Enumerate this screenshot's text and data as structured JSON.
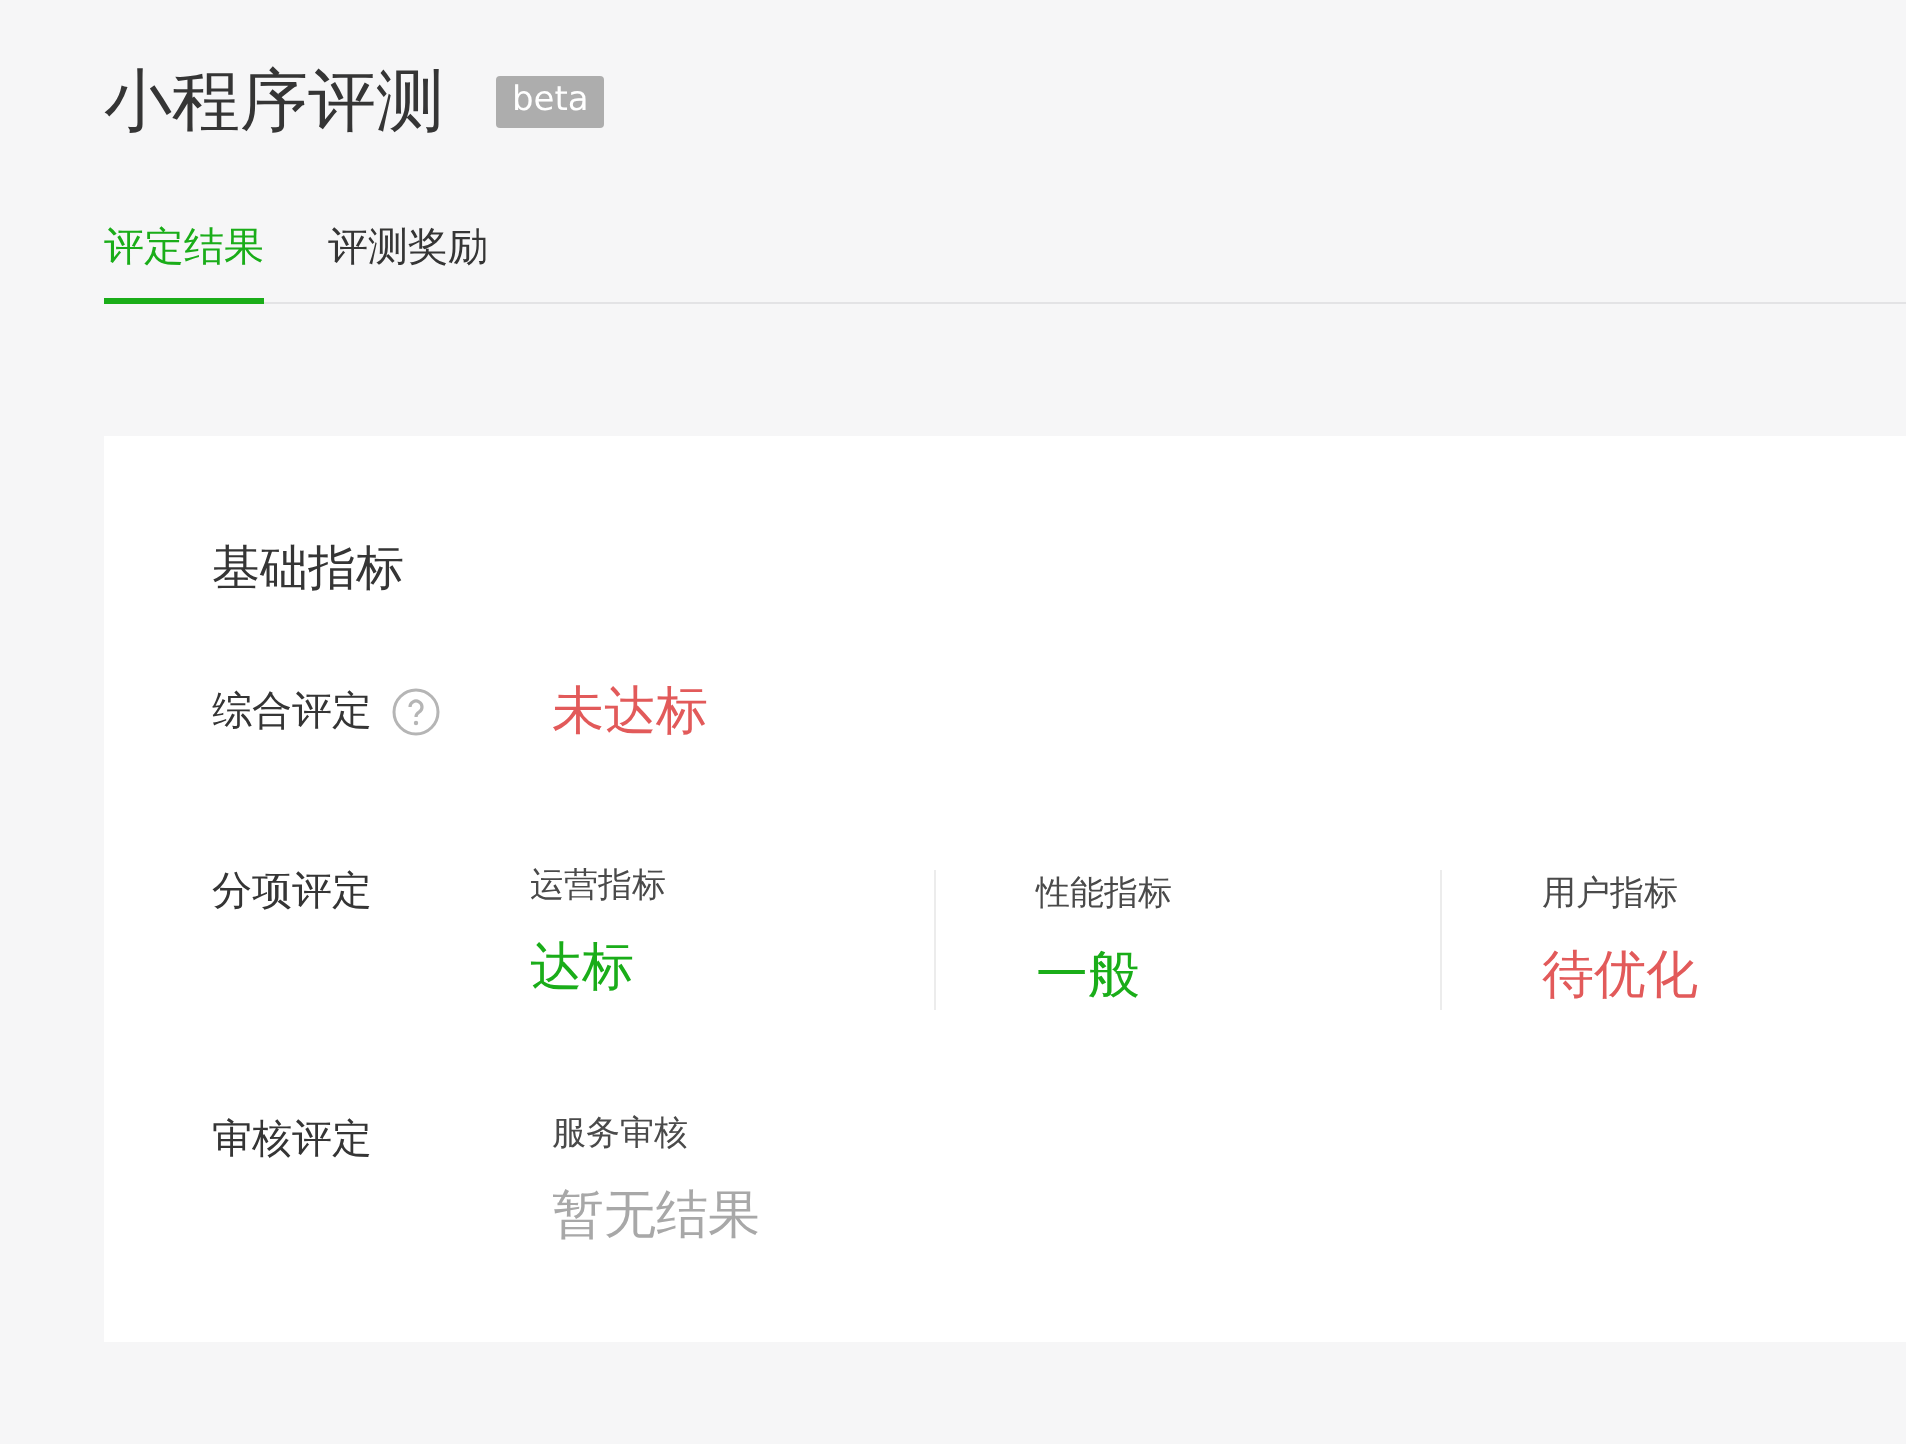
{
  "header": {
    "title": "小程序评测",
    "badge": "beta"
  },
  "tabs": [
    {
      "label": "评定结果",
      "selected": true
    },
    {
      "label": "评测奖励",
      "selected": false
    }
  ],
  "card": {
    "title": "基础指标",
    "overall": {
      "label": "综合评定",
      "result": "未达标",
      "kind": "bad"
    },
    "rows": [
      {
        "label": "分项评定",
        "items": [
          {
            "name": "运营指标",
            "result": "达标",
            "kind": "good"
          },
          {
            "name": "性能指标",
            "result": "一般",
            "kind": "good"
          },
          {
            "name": "用户指标",
            "result": "待优化",
            "kind": "bad"
          }
        ]
      },
      {
        "label": "审核评定",
        "items": [
          {
            "name": "服务审核",
            "result": "暂无结果",
            "kind": "none"
          }
        ]
      }
    ]
  }
}
